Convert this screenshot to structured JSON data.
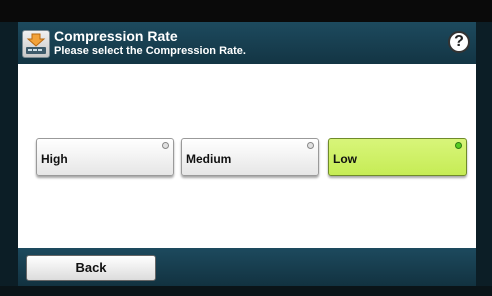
{
  "header": {
    "title": "Compression Rate",
    "subtitle": "Please select the Compression Rate.",
    "help_icon": "question-mark-icon",
    "app_icon": "scanner-icon"
  },
  "options": [
    {
      "label": "High",
      "selected": false
    },
    {
      "label": "Medium",
      "selected": false
    },
    {
      "label": "Low",
      "selected": true
    }
  ],
  "footer": {
    "back_label": "Back"
  },
  "colors": {
    "header_bg": "#1d4a5e",
    "selected_bg": "#c6ec55",
    "selected_indicator": "#55cc22"
  }
}
